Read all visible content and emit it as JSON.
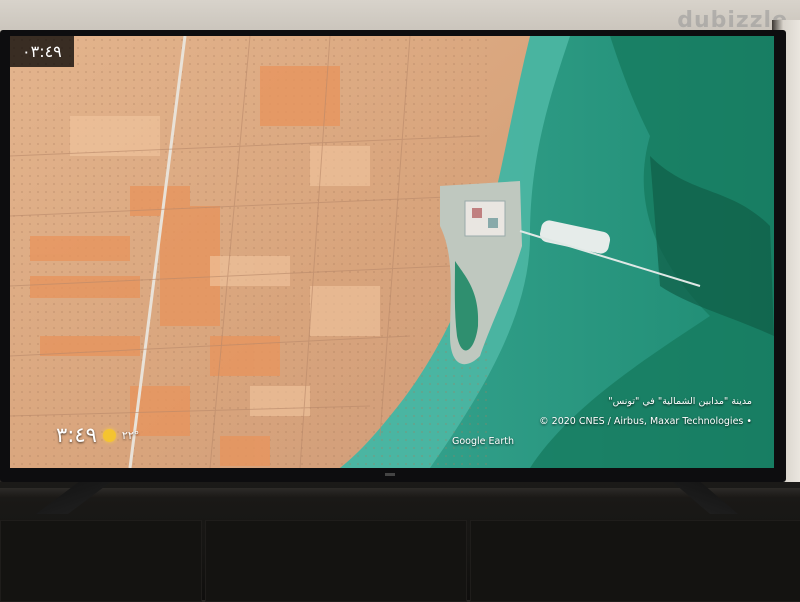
{
  "watermark": {
    "text": "dubizzle"
  },
  "screensaver": {
    "clock_badge": "٠٣:٤٩",
    "time": "٣:٤٩",
    "temperature": "٢٢°",
    "weather_icon": "sun-icon",
    "location": "مدينة \"مدابين الشمالية\" في \"تونس\"",
    "copyright": "© 2020 CNES / Airbus, Maxar Technologies •",
    "provider": "Google Earth"
  },
  "colors": {
    "land": "#d9a57c",
    "water": "#2a9a84",
    "sun": "#f4c430"
  }
}
